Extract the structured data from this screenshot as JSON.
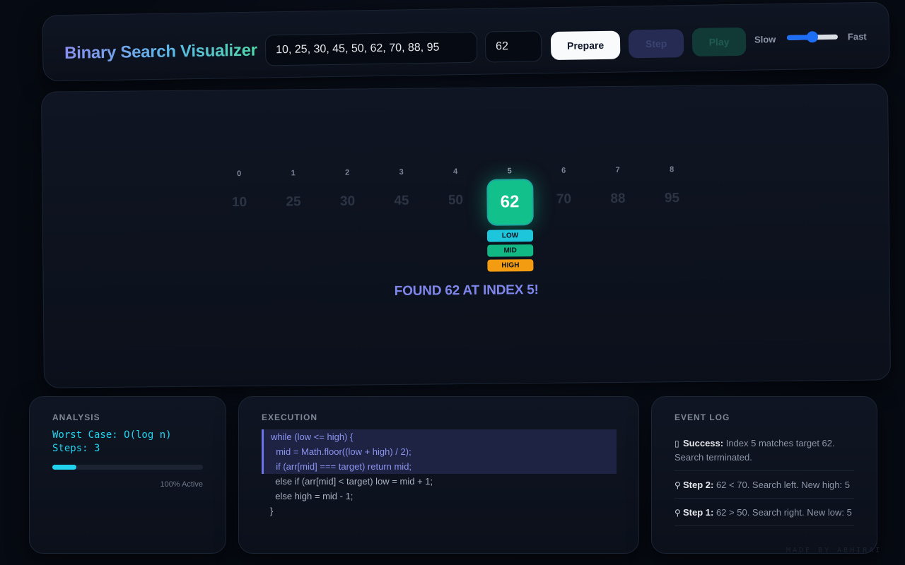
{
  "header": {
    "title": "Binary Search Visualizer",
    "array_value": "10, 25, 30, 45, 50, 62, 70, 88, 95",
    "target_value": "62",
    "prepare_label": "Prepare",
    "step_label": "Step",
    "play_label": "Play",
    "slow_label": "Slow",
    "fast_label": "Fast",
    "speed_level": 0.5
  },
  "visualizer": {
    "cells": [
      {
        "index": "0",
        "value": "10"
      },
      {
        "index": "1",
        "value": "25"
      },
      {
        "index": "2",
        "value": "30"
      },
      {
        "index": "3",
        "value": "45"
      },
      {
        "index": "4",
        "value": "50"
      },
      {
        "index": "5",
        "value": "62"
      },
      {
        "index": "6",
        "value": "70"
      },
      {
        "index": "7",
        "value": "88"
      },
      {
        "index": "8",
        "value": "95"
      }
    ],
    "active_index": 5,
    "pointers": {
      "low": "LOW",
      "mid": "MID",
      "high": "HIGH"
    },
    "status": "FOUND 62 AT INDEX 5!"
  },
  "analysis": {
    "title": "ANALYSIS",
    "worst_case": "Worst Case: O(log n)",
    "steps": "Steps: 3",
    "progress_fraction": 0.16,
    "active_label": "100% Active"
  },
  "execution": {
    "title": "EXECUTION",
    "lines": [
      {
        "text": "while (low <= high) {",
        "highlight": true
      },
      {
        "text": "  mid = Math.floor((low + high) / 2);",
        "highlight": true
      },
      {
        "text": "  if (arr[mid] === target) return mid;",
        "highlight": true
      },
      {
        "text": "  else if (arr[mid] < target) low = mid + 1;",
        "highlight": false
      },
      {
        "text": "  else high = mid - 1;",
        "highlight": false
      },
      {
        "text": "}",
        "highlight": false
      }
    ]
  },
  "event_log": {
    "title": "EVENT LOG",
    "entries": [
      {
        "icon": "success-icon",
        "label": "Success:",
        "text": " Index 5 matches target 62. Search terminated."
      },
      {
        "icon": "magnifier-icon",
        "label": "Step 2:",
        "text": " 62 < 70. Search left. New high: 5"
      },
      {
        "icon": "magnifier-icon",
        "label": "Step 1:",
        "text": " 62 > 50. Search right. New low: 5"
      }
    ]
  },
  "watermark": "MADE BY ABHIRAI",
  "colors": {
    "accent_indigo": "#8087ec",
    "found_green": "#12c08b",
    "low_cyan": "#1ec6dc",
    "mid_green": "#12b884",
    "high_orange": "#f39c12"
  }
}
